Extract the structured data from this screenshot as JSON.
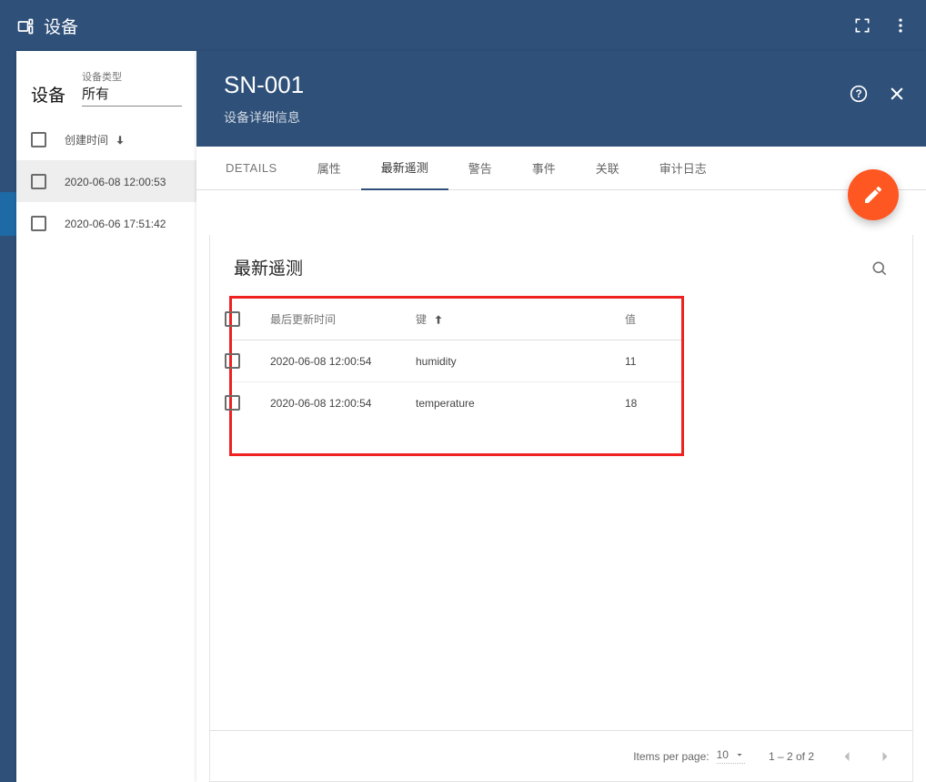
{
  "topbar": {
    "title": "设备"
  },
  "sidebar": {
    "heading": "设备",
    "type_label": "设备类型",
    "type_value": "所有",
    "sort_label": "创建时间",
    "rows": [
      {
        "time": "2020-06-08 12:00:53",
        "selected": true
      },
      {
        "time": "2020-06-06 17:51:42",
        "selected": false
      }
    ]
  },
  "detail": {
    "title": "SN-001",
    "subtitle": "设备详细信息",
    "tabs": [
      "DETAILS",
      "属性",
      "最新遥测",
      "警告",
      "事件",
      "关联",
      "审计日志"
    ],
    "active_tab_index": 2,
    "section_title": "最新遥测",
    "columns": {
      "time": "最后更新时间",
      "key": "键",
      "value": "值"
    },
    "rows": [
      {
        "time": "2020-06-08 12:00:54",
        "key": "humidity",
        "value": "11"
      },
      {
        "time": "2020-06-08 12:00:54",
        "key": "temperature",
        "value": "18"
      }
    ],
    "footer": {
      "items_label": "Items per page:",
      "per_page": "10",
      "range": "1 – 2 of 2"
    }
  },
  "colors": {
    "accent": "#fe5722",
    "primary": "#2f5079"
  }
}
